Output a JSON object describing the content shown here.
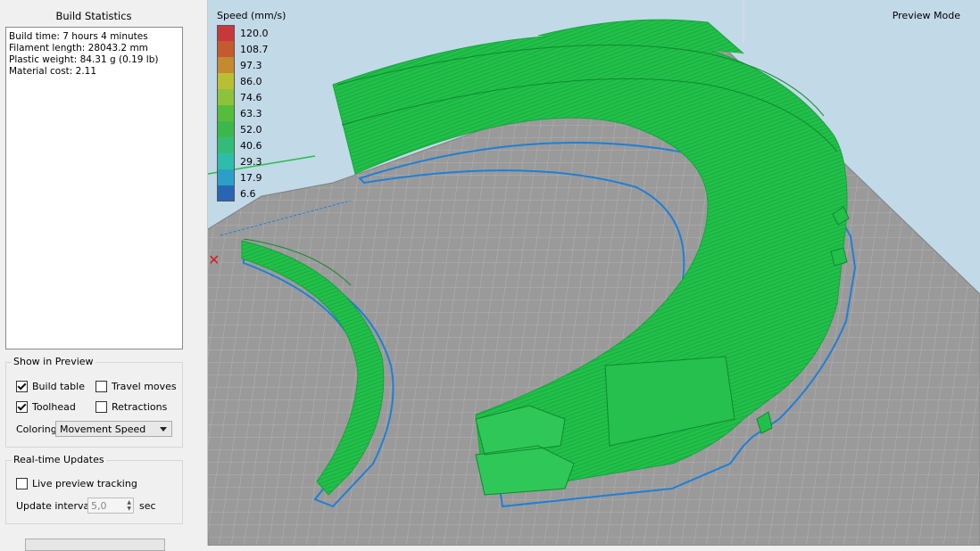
{
  "sidebar": {
    "build_stats_title": "Build Statistics",
    "stats": {
      "build_time": "Build time: 7 hours 4 minutes",
      "filament_length": "Filament length: 28043.2 mm",
      "plastic_weight": "Plastic weight: 84.31 g (0.19 lb)",
      "material_cost": "Material cost: 2.11"
    },
    "show_in_preview": {
      "title": "Show in Preview",
      "build_table": {
        "label": "Build table",
        "checked": true
      },
      "travel_moves": {
        "label": "Travel moves",
        "checked": false
      },
      "toolhead": {
        "label": "Toolhead",
        "checked": true
      },
      "retractions": {
        "label": "Retractions",
        "checked": false
      },
      "coloring_label": "Coloring",
      "coloring_value": "Movement Speed"
    },
    "realtime": {
      "title": "Real-time Updates",
      "live_preview": {
        "label": "Live preview tracking",
        "checked": false
      },
      "interval_label": "Update interval",
      "interval_value": "5,0",
      "interval_unit": "sec"
    }
  },
  "viewport": {
    "mode_label": "Preview Mode",
    "legend_title": "Speed (mm/s)",
    "legend": [
      {
        "label": "120.0",
        "color": "#c8383a"
      },
      {
        "label": "108.7",
        "color": "#c45a2e"
      },
      {
        "label": "97.3",
        "color": "#c48a30"
      },
      {
        "label": "86.0",
        "color": "#b9bf35"
      },
      {
        "label": "74.6",
        "color": "#8cc33a"
      },
      {
        "label": "63.3",
        "color": "#56bd3c"
      },
      {
        "label": "52.0",
        "color": "#3bb84a"
      },
      {
        "label": "40.6",
        "color": "#33bc78"
      },
      {
        "label": "29.3",
        "color": "#2ebdaa"
      },
      {
        "label": "17.9",
        "color": "#2a9fc8"
      },
      {
        "label": "6.6",
        "color": "#2866b3"
      }
    ],
    "colors": {
      "print": "#22c04a",
      "outline": "#1f7fd6",
      "bed": "#9a9a9a",
      "background": "#c2d9e8"
    }
  }
}
